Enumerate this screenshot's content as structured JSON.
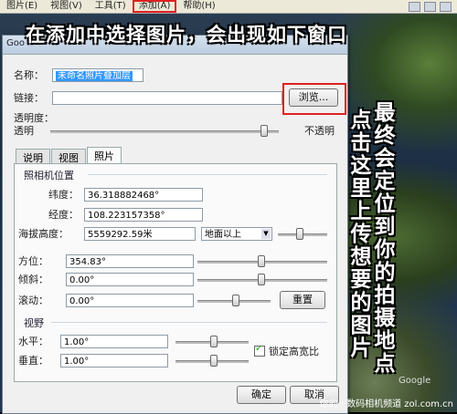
{
  "menubar": {
    "items": [
      "图片(E)",
      "视图(V)",
      "工具(T)",
      "添加(A)",
      "帮助(H)"
    ]
  },
  "dialog": {
    "title": "Goo",
    "name_label": "名称：",
    "name_value": "未命名照片叠加层",
    "link_label": "链接：",
    "link_value": "",
    "browse_label": "浏览...",
    "opacity_label": "透明度：",
    "transparent_label": "透明",
    "opaque_label": "不透明",
    "opacity_level": 0.93,
    "tabs": [
      "说明",
      "视图",
      "照片"
    ],
    "camera": {
      "group_title": "照相机位置",
      "lat_label": "纬度：",
      "lat_value": "36.318882468°",
      "lon_label": "经度：",
      "lon_value": "108.223157358°",
      "alt_label": "海拔高度：",
      "alt_value": "5559292.59米",
      "alt_mode": "地面以上",
      "heading_label": "方位：",
      "heading_value": "354.83°",
      "tilt_label": "倾斜：",
      "tilt_value": "0.00°",
      "roll_label": "滚动：",
      "roll_value": "0.00°",
      "reset_label": "重置"
    },
    "view": {
      "group_title": "视野",
      "h_label": "水平：",
      "h_value": "1.00°",
      "v_label": "垂直：",
      "v_value": "1.00°",
      "lock_label": "锁定高宽比"
    },
    "ok_label": "确定",
    "cancel_label": "取消"
  },
  "overlay": {
    "caption": "在添加中选择图片，会出现如下窗口",
    "vertical_right": "最终会定位到你的拍摄地点",
    "vertical_left": "点击这里上传想要的图片",
    "watermark": "你的 · 数码相机频道 zol.com.cn",
    "google_text": "Google"
  },
  "colors": {
    "highlight_box": "#e02020",
    "selection": "#3399ff"
  }
}
